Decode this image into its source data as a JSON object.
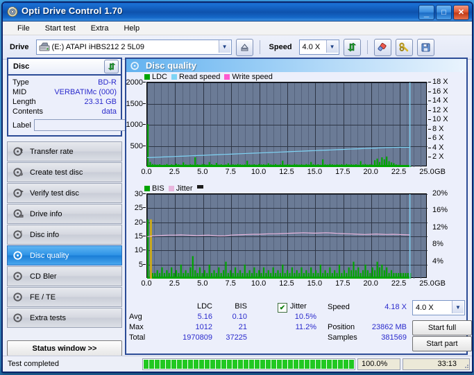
{
  "window": {
    "title": "Opti Drive Control 1.70",
    "icon": "disc-icon",
    "minimize_label": "_",
    "maximize_label": "□",
    "close_label": "✕"
  },
  "menubar": {
    "items": [
      {
        "label": "File",
        "accel": "F"
      },
      {
        "label": "Start test",
        "accel": "S"
      },
      {
        "label": "Extra",
        "accel": "x"
      },
      {
        "label": "Help",
        "accel": "H"
      }
    ]
  },
  "toolbar": {
    "drive_label": "Drive",
    "drive_value": "(E:)   ATAPI iHBS212  2 5L09",
    "drive_letter": "(E:)",
    "drive_name": "ATAPI iHBS212  2 5L09",
    "eject_icon": "eject-icon",
    "speed_label": "Speed",
    "speed_value": "4.0 X",
    "refresh_icon": "refresh-icon",
    "erase_icon": "eraser-icon",
    "tools_icon": "tools-icon",
    "save_icon": "save-icon"
  },
  "disc_panel": {
    "title": "Disc",
    "refresh_icon": "refresh-icon",
    "disc_icon": "cd-icon",
    "rows": [
      {
        "key": "Type",
        "value": "BD-R"
      },
      {
        "key": "MID",
        "value": "VERBATIMc (000)"
      },
      {
        "key": "Length",
        "value": "23.31 GB"
      },
      {
        "key": "Contents",
        "value": "data"
      }
    ],
    "label_key": "Label",
    "label_value": "",
    "label_placeholder": ""
  },
  "nav": {
    "items": [
      {
        "label": "Transfer rate",
        "icon": "disc-speed-icon",
        "selected": false
      },
      {
        "label": "Create test disc",
        "icon": "disc-write-icon",
        "selected": false
      },
      {
        "label": "Verify test disc",
        "icon": "disc-verify-icon",
        "selected": false
      },
      {
        "label": "Drive info",
        "icon": "drive-info-icon",
        "selected": false
      },
      {
        "label": "Disc info",
        "icon": "disc-info-icon",
        "selected": false
      },
      {
        "label": "Disc quality",
        "icon": "disc-quality-icon",
        "selected": true
      },
      {
        "label": "CD Bler",
        "icon": "cd-bler-icon",
        "selected": false
      },
      {
        "label": "FE / TE",
        "icon": "fe-te-icon",
        "selected": false
      },
      {
        "label": "Extra tests",
        "icon": "extra-tests-icon",
        "selected": false
      }
    ],
    "status_window_label": "Status window >>"
  },
  "panel": {
    "title": "Disc quality",
    "icon": "disc-quality-icon"
  },
  "chart_data": [
    {
      "type": "area",
      "name": "ldc-chart",
      "title": "",
      "xlabel": "GB",
      "ylabel": "",
      "xlim": [
        0,
        25
      ],
      "ylim": [
        0,
        2000
      ],
      "y2lim": [
        0,
        18
      ],
      "xticks": [
        "0.0",
        "2.5",
        "5.0",
        "7.5",
        "10.0",
        "12.5",
        "15.0",
        "17.5",
        "20.0",
        "22.5",
        "25.0"
      ],
      "yticks": [
        "500",
        "1000",
        "1500",
        "2000"
      ],
      "y2ticks": [
        "2 X",
        "4 X",
        "6 X",
        "8 X",
        "10 X",
        "12 X",
        "14 X",
        "16 X",
        "18 X"
      ],
      "x_unit": "GB",
      "grid": true,
      "legend_position": "top-left",
      "legend": [
        {
          "label": "LDC",
          "color": "#00a400"
        },
        {
          "label": "Read speed",
          "color": "#7fd4f5"
        },
        {
          "label": "Write speed",
          "color": "#ff5ad0"
        }
      ],
      "series": [
        {
          "name": "LDC",
          "color": "#00a400",
          "kind": "bars",
          "values": [
            1012,
            120,
            70,
            62,
            58,
            66,
            48,
            54,
            70,
            46,
            62,
            52,
            78,
            64,
            56,
            110,
            60,
            54,
            68,
            58,
            230,
            62,
            54,
            70,
            64,
            58,
            120,
            66,
            54,
            96,
            58,
            64,
            52,
            60,
            90,
            56,
            64,
            58,
            72,
            64,
            56,
            60,
            150,
            62,
            58,
            66,
            54,
            70,
            60,
            64,
            58,
            88,
            62,
            56,
            70,
            54,
            62,
            150,
            58,
            66,
            60,
            54,
            72,
            62,
            58,
            64,
            56,
            70,
            60,
            120,
            64,
            58,
            66,
            54,
            180,
            62,
            58,
            70,
            64,
            56,
            62,
            58,
            66,
            54,
            72,
            60,
            64,
            58,
            66,
            54,
            140,
            62,
            70,
            58,
            64,
            56,
            160,
            200,
            120,
            230,
            180,
            250,
            140,
            110,
            90,
            60,
            52,
            48,
            44,
            40,
            36,
            30
          ]
        },
        {
          "name": "Read speed",
          "color": "#7fd4f5",
          "kind": "line",
          "unit": "X",
          "start": 2.0,
          "end": 4.2,
          "values": [
            2.0,
            2.05,
            2.1,
            2.15,
            2.2,
            2.25,
            2.3,
            2.35,
            2.4,
            2.45,
            2.5,
            2.55,
            2.6,
            2.65,
            2.7,
            2.75,
            2.8,
            2.85,
            2.9,
            2.95,
            3.0,
            3.05,
            3.1,
            3.15,
            3.2,
            3.25,
            3.3,
            3.35,
            3.4,
            3.45,
            3.5,
            3.55,
            3.6,
            3.65,
            3.7,
            3.75,
            3.8,
            3.85,
            3.9,
            3.95,
            4.0,
            4.05,
            4.1,
            4.15,
            4.18,
            4.2,
            4.2,
            4.2
          ]
        }
      ],
      "annotations": [
        {
          "type": "vline",
          "x": 23.4,
          "color": "#7fd4f5"
        }
      ]
    },
    {
      "type": "area",
      "name": "bis-jitter-chart",
      "title": "",
      "xlabel": "GB",
      "ylabel": "",
      "xlim": [
        0,
        25
      ],
      "ylim": [
        0,
        30
      ],
      "y2lim": [
        0,
        20
      ],
      "xticks": [
        "0.0",
        "2.5",
        "5.0",
        "7.5",
        "10.0",
        "12.5",
        "15.0",
        "17.5",
        "20.0",
        "22.5",
        "25.0"
      ],
      "yticks": [
        "5",
        "10",
        "15",
        "20",
        "25",
        "30"
      ],
      "y2ticks": [
        "4%",
        "8%",
        "12%",
        "16%",
        "20%"
      ],
      "x_unit": "GB",
      "grid": true,
      "legend_position": "top-left",
      "legend": [
        {
          "label": "BIS",
          "color": "#00a400"
        },
        {
          "label": "Jitter",
          "color": "#e8b6dd"
        },
        {
          "label": "",
          "color": "#1c1c1c"
        }
      ],
      "series": [
        {
          "name": "BIS",
          "color": "#00a400",
          "kind": "bars",
          "values": [
            21,
            3,
            2,
            2,
            3,
            2,
            4,
            2,
            3,
            2,
            4,
            2,
            3,
            2,
            5,
            2,
            3,
            2,
            4,
            8,
            3,
            2,
            4,
            2,
            3,
            2,
            5,
            2,
            3,
            2,
            4,
            2,
            3,
            6,
            2,
            3,
            2,
            4,
            2,
            3,
            2,
            5,
            2,
            3,
            2,
            4,
            2,
            3,
            2,
            4,
            2,
            3,
            2,
            4,
            2,
            3,
            2,
            5,
            2,
            3,
            2,
            4,
            2,
            3,
            2,
            4,
            2,
            3,
            2,
            4,
            2,
            3,
            2,
            5,
            2,
            3,
            2,
            4,
            2,
            3,
            2,
            5,
            2,
            3,
            2,
            4,
            3,
            6,
            3,
            4,
            2,
            3,
            5,
            3,
            2,
            4,
            3,
            6,
            4,
            5,
            3,
            4,
            2,
            3,
            2,
            2,
            2,
            2,
            2,
            2,
            2,
            2
          ]
        },
        {
          "name": "Jitter",
          "color": "#e8b6dd",
          "kind": "line",
          "unit": "%",
          "avg": 10.5,
          "max": 11.2,
          "values": [
            9.9,
            10.1,
            10.2,
            10.25,
            10.3,
            10.3,
            10.35,
            10.3,
            10.25,
            10.2,
            10.25,
            10.3,
            10.2,
            10.1,
            10.15,
            10.3,
            10.35,
            10.4,
            10.45,
            10.5,
            10.5,
            10.55,
            10.6,
            10.6,
            10.65,
            10.7,
            10.75,
            10.8,
            10.85,
            10.8,
            10.75,
            10.8,
            10.85,
            10.8,
            10.7,
            10.65,
            10.6,
            10.55,
            10.5,
            10.45,
            10.5,
            10.55,
            10.5,
            10.45,
            10.5,
            10.45,
            10.4,
            10.35
          ]
        }
      ],
      "annotations": [
        {
          "type": "vline",
          "x": 23.4,
          "color": "#7fd4f5"
        }
      ]
    }
  ],
  "stats": {
    "columns": [
      "LDC",
      "BIS"
    ],
    "jitter_label": "Jitter",
    "jitter_checked": true,
    "rows": [
      {
        "label": "Avg",
        "ldc": "5.16",
        "bis": "0.10",
        "jitter": "10.5%"
      },
      {
        "label": "Max",
        "ldc": "1012",
        "bis": "21",
        "jitter": "11.2%"
      },
      {
        "label": "Total",
        "ldc": "1970809",
        "bis": "37225",
        "jitter": ""
      }
    ],
    "info": [
      {
        "key": "Speed",
        "value": "4.18 X"
      },
      {
        "key": "Position",
        "value": "23862 MB"
      },
      {
        "key": "Samples",
        "value": "381569"
      }
    ],
    "speed_select": "4.0 X",
    "start_full_label": "Start full",
    "start_part_label": "Start part"
  },
  "statusbar": {
    "message": "Test completed",
    "progress_percent": "100.0%",
    "progress_value": 100,
    "elapsed": "33:13"
  },
  "colors": {
    "accent_blue": "#1363c6",
    "value_blue": "#2a2acc",
    "ldc_green": "#00a400",
    "read_speed": "#7fd4f5",
    "write_speed": "#ff5ad0",
    "jitter_pink": "#e8b6dd",
    "plot_bg": "#6b7b96",
    "selected_nav": "#2e93e6"
  }
}
